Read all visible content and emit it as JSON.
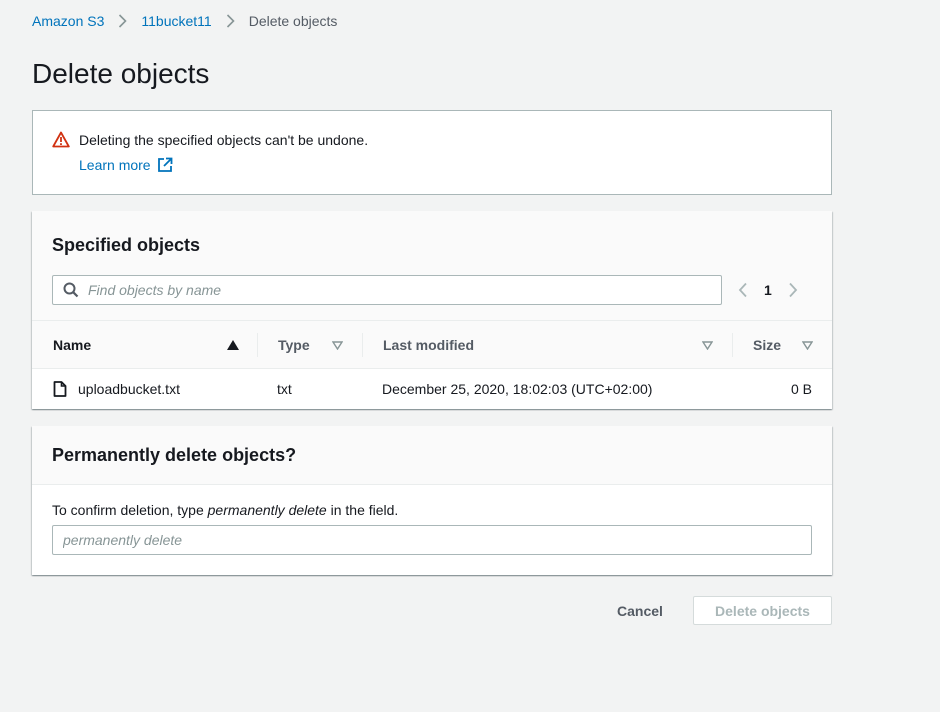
{
  "breadcrumb": {
    "items": [
      {
        "label": "Amazon S3"
      },
      {
        "label": "11bucket11"
      },
      {
        "label": "Delete objects"
      }
    ]
  },
  "page": {
    "title": "Delete objects"
  },
  "alert": {
    "message": "Deleting the specified objects can't be undone.",
    "link_label": "Learn more",
    "icon": "warning-triangle-icon",
    "link_icon": "external-link-icon"
  },
  "specified_objects": {
    "title": "Specified objects",
    "search_placeholder": "Find objects by name",
    "pagination": {
      "current_page": "1"
    },
    "columns": [
      "Name",
      "Type",
      "Last modified",
      "Size"
    ],
    "rows": [
      {
        "name": "uploadbucket.txt",
        "type": "txt",
        "last_modified": "December 25, 2020, 18:02:03 (UTC+02:00)",
        "size": "0 B"
      }
    ]
  },
  "confirm": {
    "title": "Permanently delete objects?",
    "instruction_prefix": "To confirm deletion, type ",
    "instruction_em": "permanently delete",
    "instruction_suffix": " in the field.",
    "input_placeholder": "permanently delete",
    "input_value": ""
  },
  "actions": {
    "cancel_label": "Cancel",
    "delete_label": "Delete objects"
  },
  "colors": {
    "link": "#0073bb",
    "warning": "#d13212",
    "background": "#f2f3f3",
    "disabled_text": "#aab7b8"
  }
}
